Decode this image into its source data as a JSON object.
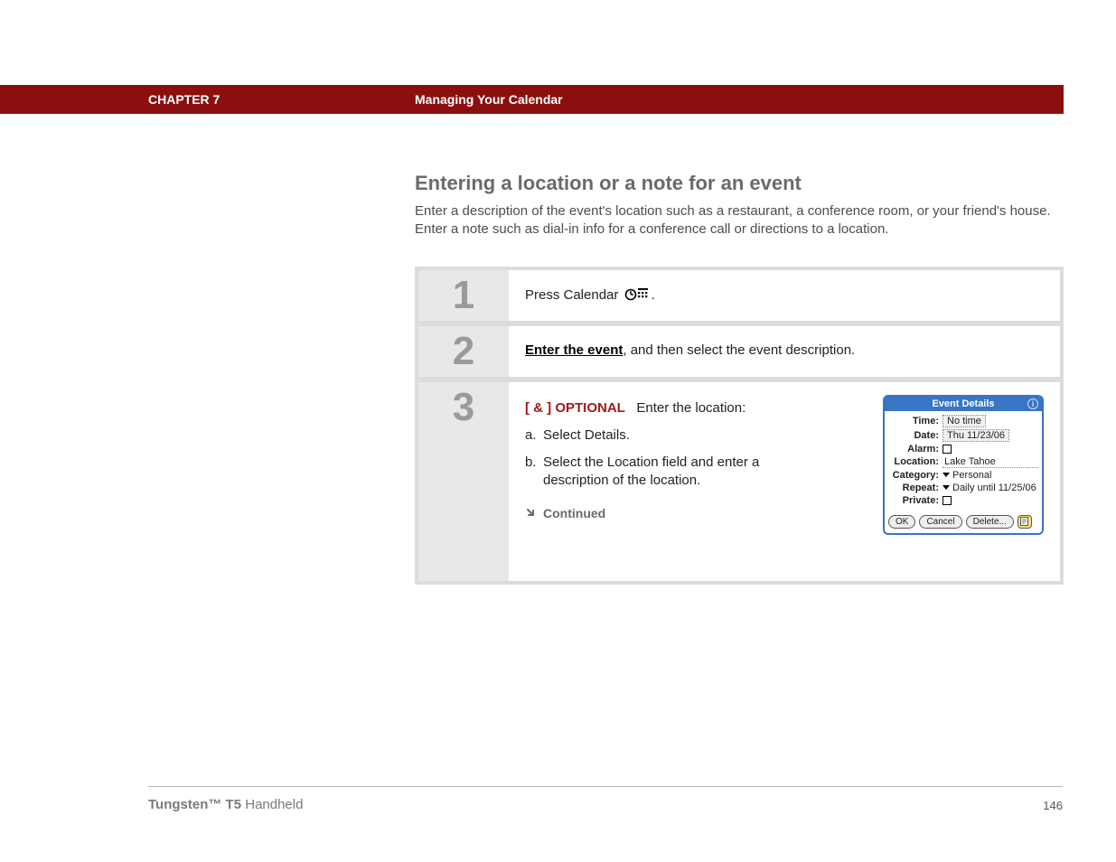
{
  "header": {
    "chapter": "CHAPTER 7",
    "title": "Managing Your Calendar"
  },
  "section": {
    "heading": "Entering a location or a note for an event",
    "intro": "Enter a description of the event's location such as a restaurant, a conference room, or your friend's house. Enter a note such as dial-in info for a conference call or directions to a location."
  },
  "steps": {
    "s1": {
      "num": "1",
      "text_before": "Press Calendar ",
      "text_after": "."
    },
    "s2": {
      "num": "2",
      "link": "Enter the event",
      "rest": ", and then select the event description."
    },
    "s3": {
      "num": "3",
      "optional_tag": "[ & ]  OPTIONAL",
      "lead": "Enter the location:",
      "a": "Select Details.",
      "b": "Select the Location field and enter a description of the location.",
      "continued": "Continued"
    }
  },
  "dialog": {
    "title": "Event Details",
    "time_label": "Time:",
    "time_value": "No time",
    "date_label": "Date:",
    "date_value": "Thu 11/23/06",
    "alarm_label": "Alarm:",
    "location_label": "Location:",
    "location_value": "Lake Tahoe",
    "category_label": "Category:",
    "category_value": "Personal",
    "repeat_label": "Repeat:",
    "repeat_value": "Daily until 11/25/06",
    "private_label": "Private:",
    "ok": "OK",
    "cancel": "Cancel",
    "delete": "Delete..."
  },
  "footer": {
    "product_bold": "Tungsten™ T5",
    "product_rest": " Handheld",
    "page": "146"
  }
}
